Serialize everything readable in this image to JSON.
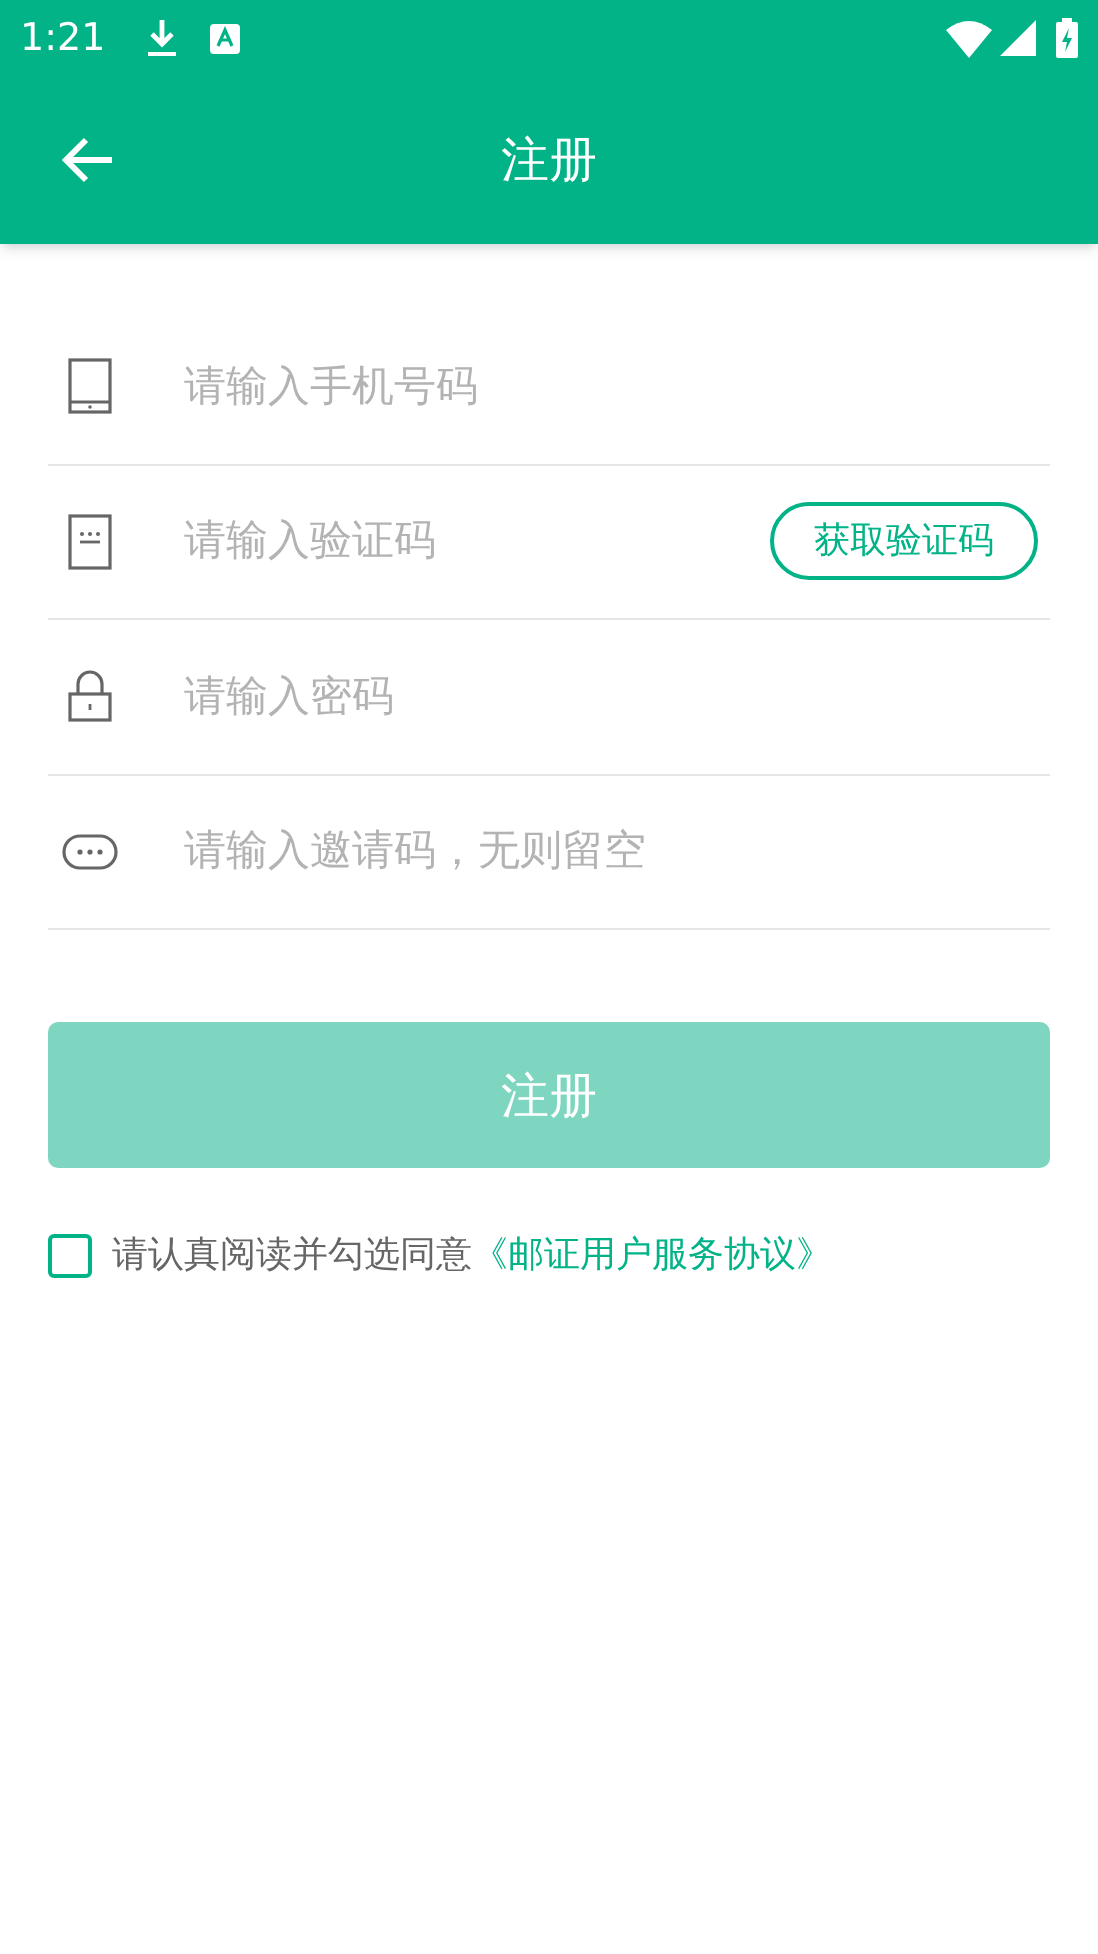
{
  "status_bar": {
    "time": "1:21"
  },
  "toolbar": {
    "title": "注册"
  },
  "fields": [
    {
      "kind": "phone",
      "placeholder": "请输入手机号码"
    },
    {
      "kind": "code",
      "placeholder": "请输入验证码",
      "action": "获取验证码"
    },
    {
      "kind": "lock",
      "placeholder": "请输入密码"
    },
    {
      "kind": "chat",
      "placeholder": "请输入邀请码，无则留空"
    }
  ],
  "register_button": {
    "label": "注册",
    "disabled": true
  },
  "agreement": {
    "checked": false,
    "text": "请认真阅读并勾选同意",
    "link": "《邮证用户服务协议》"
  }
}
